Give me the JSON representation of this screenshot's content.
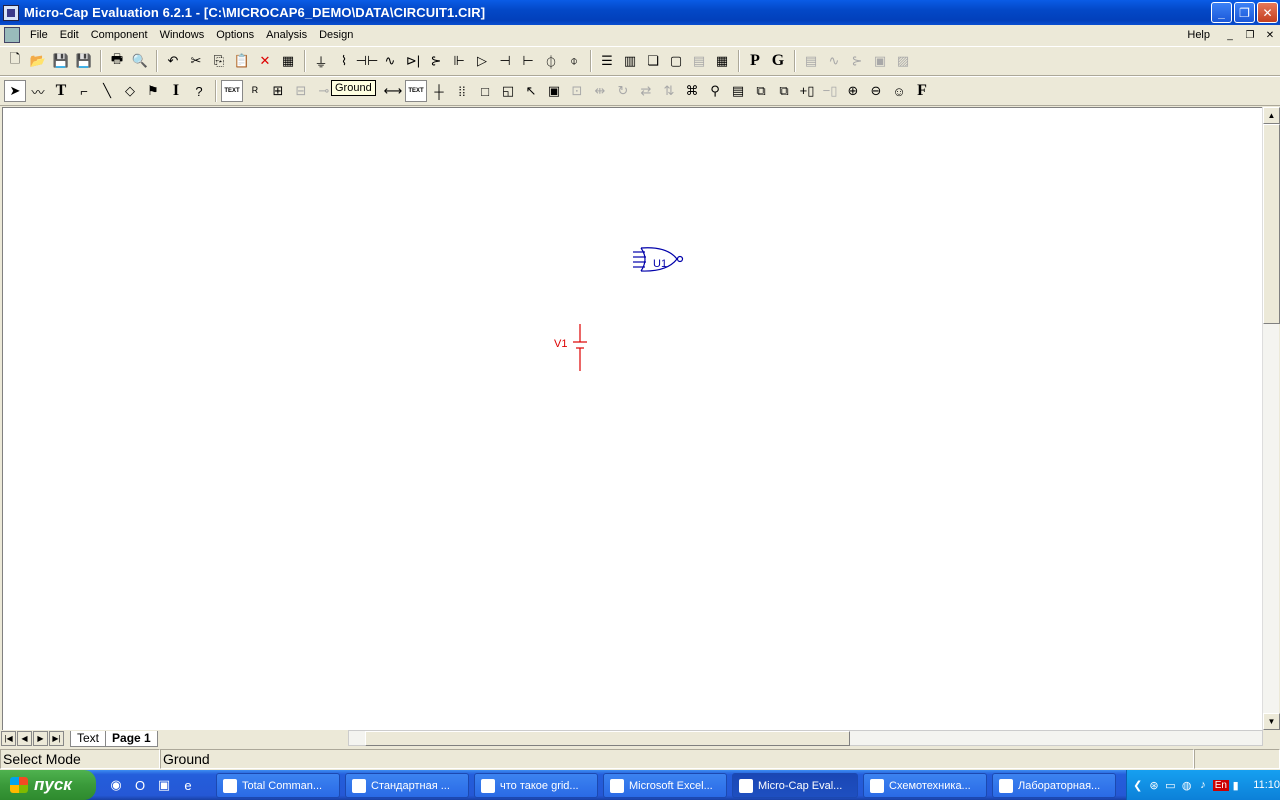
{
  "window": {
    "title": "Micro-Cap Evaluation 6.2.1 - [C:\\MICROCAP6_DEMO\\DATA\\CIRCUIT1.CIR]"
  },
  "menu": {
    "items": [
      "File",
      "Edit",
      "Component",
      "Windows",
      "Options",
      "Analysis",
      "Design"
    ],
    "help": "Help"
  },
  "toolbar1": {
    "p_label": "P",
    "g_label": "G"
  },
  "toolbar2": {
    "text_label": "T",
    "info_label": "I",
    "text_mode": "TEXT",
    "text_mode2": "TEXT",
    "font_label": "F"
  },
  "tooltip": "Ground",
  "schematic": {
    "u1_label": "U1",
    "v1_label": "V1"
  },
  "tabs": [
    "Text",
    "Page 1"
  ],
  "status": {
    "mode": "Select Mode",
    "message": "Ground"
  },
  "taskbar": {
    "start_label": "пуск",
    "tasks": [
      "Total Comman...",
      "Стандартная ...",
      "что такое grid...",
      "Microsoft Excel...",
      "Micro-Cap Eval...",
      "Схемотехника...",
      "Лабораторная..."
    ],
    "lang": "En",
    "clock": "11:10"
  },
  "colors": {
    "schematic_blue": "#0000aa",
    "schematic_red": "#dd0000",
    "title_blue": "#0348c7"
  }
}
